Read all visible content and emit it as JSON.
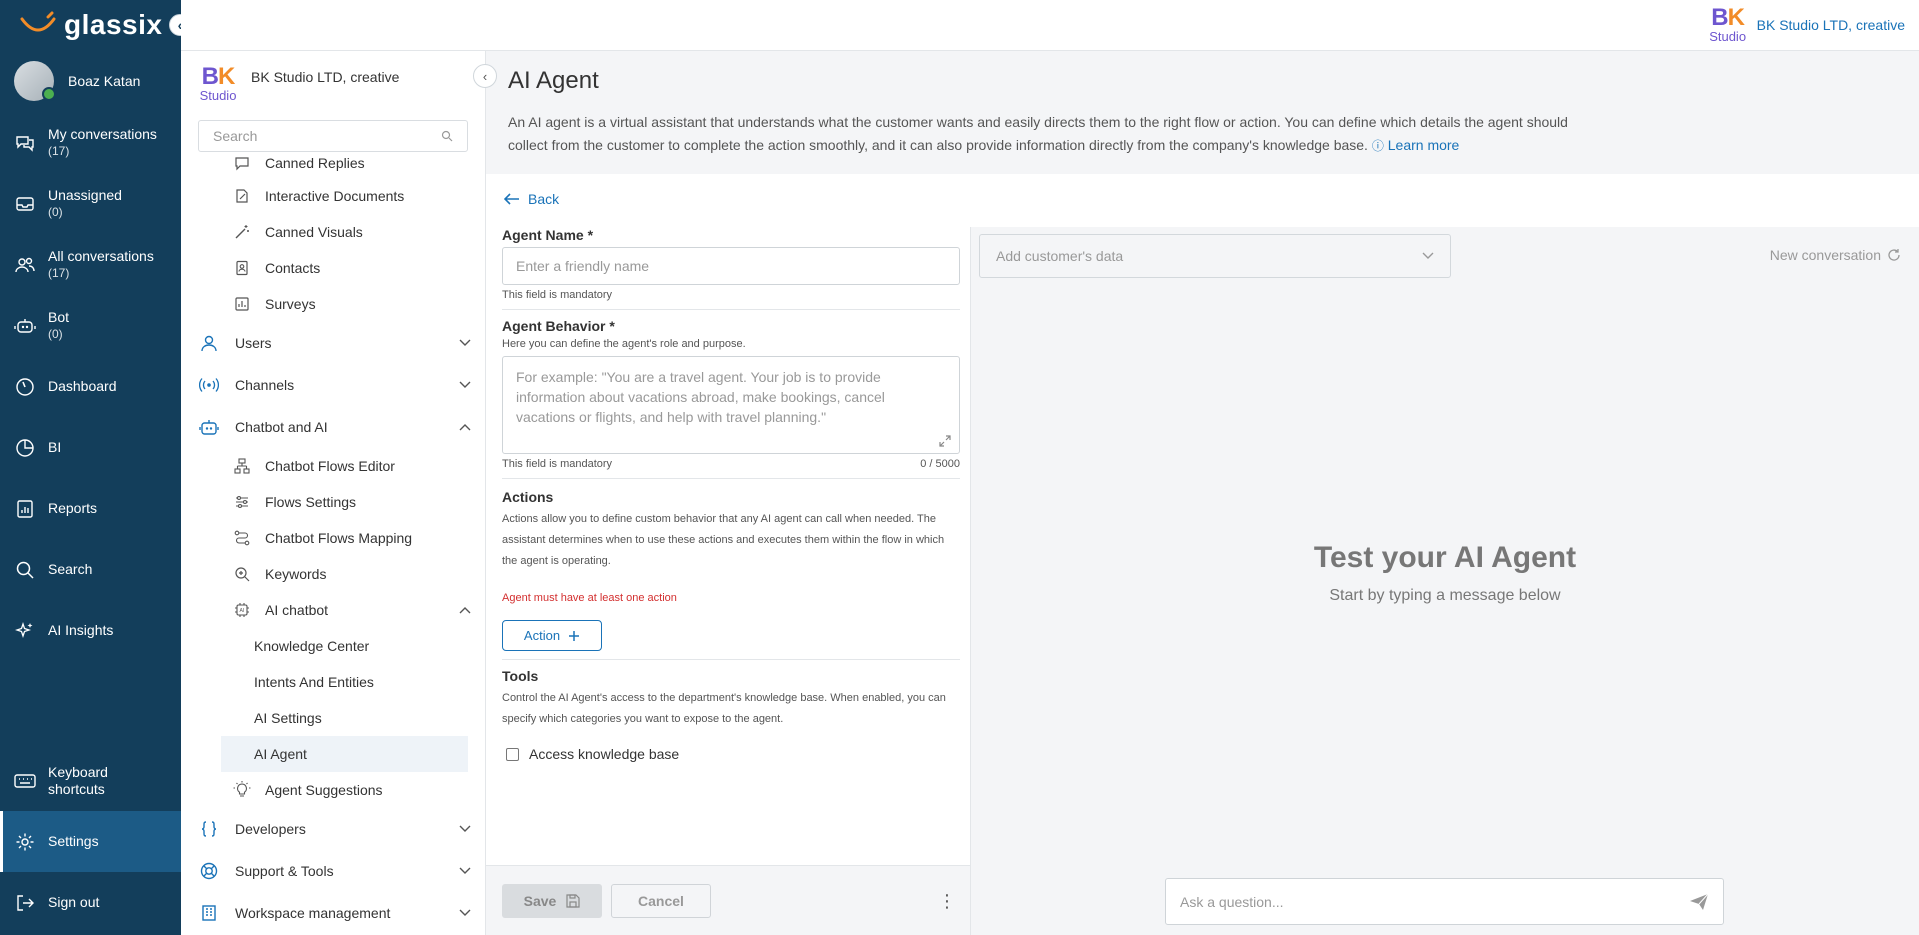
{
  "app": {
    "logo_text": "glassix"
  },
  "user": {
    "name": "Boaz Katan"
  },
  "leftnav": {
    "items": [
      {
        "label": "My conversations",
        "count": "(17)"
      },
      {
        "label": "Unassigned",
        "count": "(0)"
      },
      {
        "label": "All conversations",
        "count": "(17)"
      },
      {
        "label": "Bot",
        "count": "(0)"
      },
      {
        "label": "Dashboard"
      },
      {
        "label": "BI"
      },
      {
        "label": "Reports"
      },
      {
        "label": "Search"
      },
      {
        "label": "AI Insights"
      }
    ],
    "bottom": [
      {
        "label": "Keyboard shortcuts"
      },
      {
        "label": "Settings"
      },
      {
        "label": "Sign out"
      }
    ]
  },
  "brand": {
    "bk": "BK",
    "studio": "Studio",
    "name": "BK Studio LTD, creative"
  },
  "sidebar": {
    "org": "BK Studio LTD, creative",
    "search_placeholder": "Search",
    "items": [
      "Canned Replies",
      "Interactive Documents",
      "Canned Visuals",
      "Contacts",
      "Surveys",
      "Users",
      "Channels",
      "Chatbot and AI",
      "Chatbot Flows Editor",
      "Flows Settings",
      "Chatbot Flows Mapping",
      "Keywords",
      "AI chatbot",
      "Knowledge Center",
      "Intents And Entities",
      "AI Settings",
      "AI Agent",
      "Agent Suggestions",
      "Developers",
      "Support & Tools",
      "Workspace management"
    ]
  },
  "page": {
    "title": "AI Agent",
    "description": "An AI agent is a virtual assistant that understands what the customer wants and easily directs them to the right flow or action. You can define which details the agent should collect from the customer to complete the action smoothly, and it can also provide information directly from the company's knowledge base.",
    "learn_more": "Learn more",
    "back": "Back"
  },
  "form": {
    "agent_name_label": "Agent Name *",
    "agent_name_placeholder": "Enter a friendly name",
    "mandatory": "This field is mandatory",
    "behavior_label": "Agent Behavior *",
    "behavior_help": "Here you can define the agent's role and purpose.",
    "behavior_placeholder": "For example: \"You are a travel agent. Your job is to provide information about vacations abroad, make bookings, cancel vacations or flights, and help with travel planning.\"",
    "counter": "0 / 5000",
    "actions_label": "Actions",
    "actions_text": "Actions allow you to define custom behavior that any AI agent can call when needed. The assistant determines when to use these actions and executes them within the flow in which the agent is operating.",
    "actions_error": "Agent must have at least one action",
    "action_button": "Action",
    "tools_label": "Tools",
    "tools_text": "Control the AI Agent's access to the department's knowledge base. When enabled, you can specify which categories you want to expose to the agent.",
    "access_kb": "Access knowledge base",
    "save": "Save",
    "cancel": "Cancel"
  },
  "test": {
    "customer_data_placeholder": "Add customer's data",
    "new_conversation": "New conversation",
    "title": "Test your AI Agent",
    "subtitle": "Start by typing a message below",
    "ask_placeholder": "Ask a question..."
  },
  "colors": {
    "nav_bg": "#133e5b",
    "accent": "#1a73b8",
    "error": "#d32f2f",
    "brand_purple": "#6e56cf",
    "brand_orange": "#f28c28"
  }
}
